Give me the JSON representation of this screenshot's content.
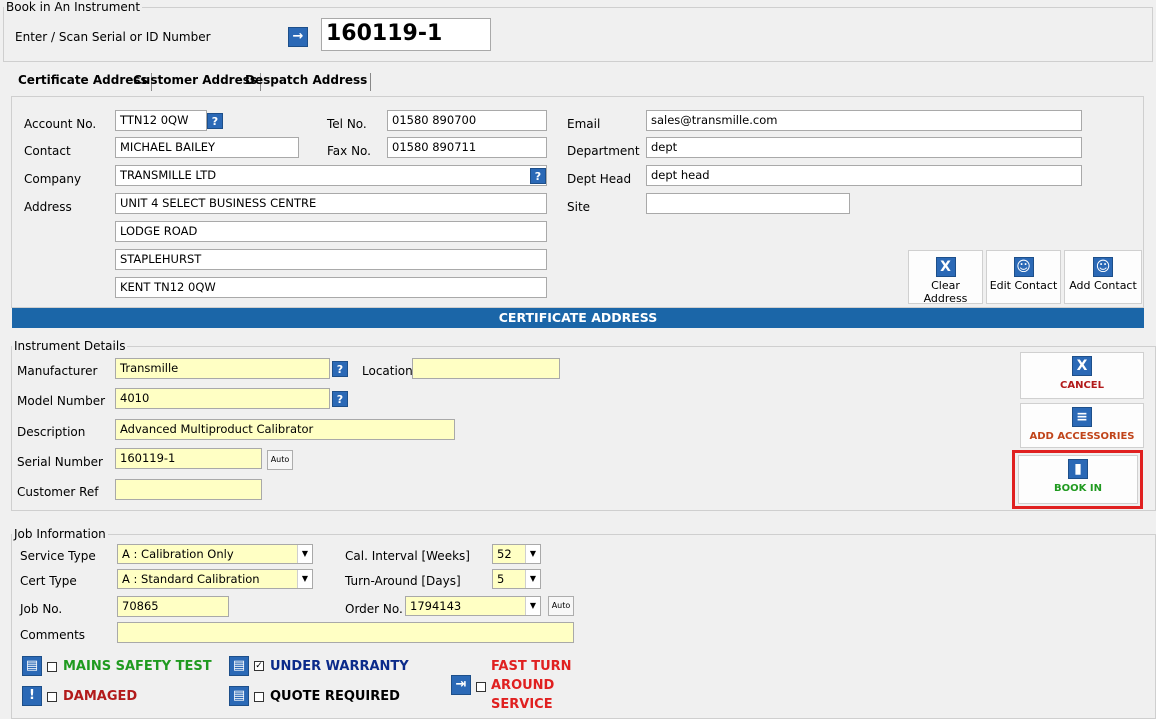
{
  "book_in": {
    "legend": "Book in An Instrument",
    "scan_label": "Enter / Scan Serial or ID Number",
    "scan_value": "160119-1"
  },
  "tabs": [
    "Certificate Address",
    "Customer Address",
    "Despatch Address"
  ],
  "address": {
    "account_label": "Account No.",
    "account_value": "TTN12 0QW",
    "contact_label": "Contact",
    "contact_value": "MICHAEL BAILEY",
    "company_label": "Company",
    "company_value": "TRANSMILLE LTD",
    "address_label": "Address",
    "address_lines": [
      "UNIT 4 SELECT BUSINESS CENTRE",
      "LODGE ROAD",
      "STAPLEHURST",
      "KENT TN12 0QW"
    ],
    "tel_label": "Tel No.",
    "tel_value": "01580 890700",
    "fax_label": "Fax No.",
    "fax_value": "01580 890711",
    "email_label": "Email",
    "email_value": "sales@transmille.com",
    "department_label": "Department",
    "department_value": "dept",
    "dept_head_label": "Dept Head",
    "dept_head_value": "dept head",
    "site_label": "Site",
    "site_value": "",
    "clear_label": "Clear Address",
    "edit_label": "Edit Contact",
    "add_label": "Add Contact",
    "banner": "CERTIFICATE ADDRESS"
  },
  "instrument": {
    "legend": "Instrument Details",
    "manufacturer_label": "Manufacturer",
    "manufacturer_value": "Transmille",
    "location_label": "Location",
    "location_value": "",
    "model_label": "Model Number",
    "model_value": "4010",
    "description_label": "Description",
    "description_value": "Advanced Multiproduct Calibrator",
    "serial_label": "Serial Number",
    "serial_value": "160119-1",
    "auto_label": "Auto",
    "custref_label": "Customer Ref",
    "custref_value": ""
  },
  "actions": {
    "cancel": "CANCEL",
    "accessories": "ADD ACCESSORIES",
    "book_in": "BOOK IN"
  },
  "job": {
    "legend": "Job Information",
    "service_label": "Service Type",
    "service_value": "A : Calibration Only",
    "cert_label": "Cert Type",
    "cert_value": "A : Standard Calibration",
    "jobno_label": "Job No.",
    "jobno_value": "70865",
    "interval_label": "Cal. Interval [Weeks]",
    "interval_value": "52",
    "turnaround_label": "Turn-Around [Days]",
    "turnaround_value": "5",
    "order_label": "Order No.",
    "order_value": "1794143",
    "auto_label": "Auto",
    "comments_label": "Comments",
    "comments_value": ""
  },
  "flags": {
    "mains": "MAINS SAFETY TEST",
    "damaged": "DAMAGED",
    "warranty": "UNDER WARRANTY",
    "quote": "QUOTE REQUIRED",
    "fast_1": "FAST TURN",
    "fast_2": "AROUND",
    "fast_3": "SERVICE"
  },
  "colors": {
    "accent": "#2b69b6",
    "banner": "#1b66a8",
    "highlight": "#e02020",
    "green": "#1f9a1f",
    "red": "#b21a1a",
    "navy": "#0b2a8a"
  }
}
